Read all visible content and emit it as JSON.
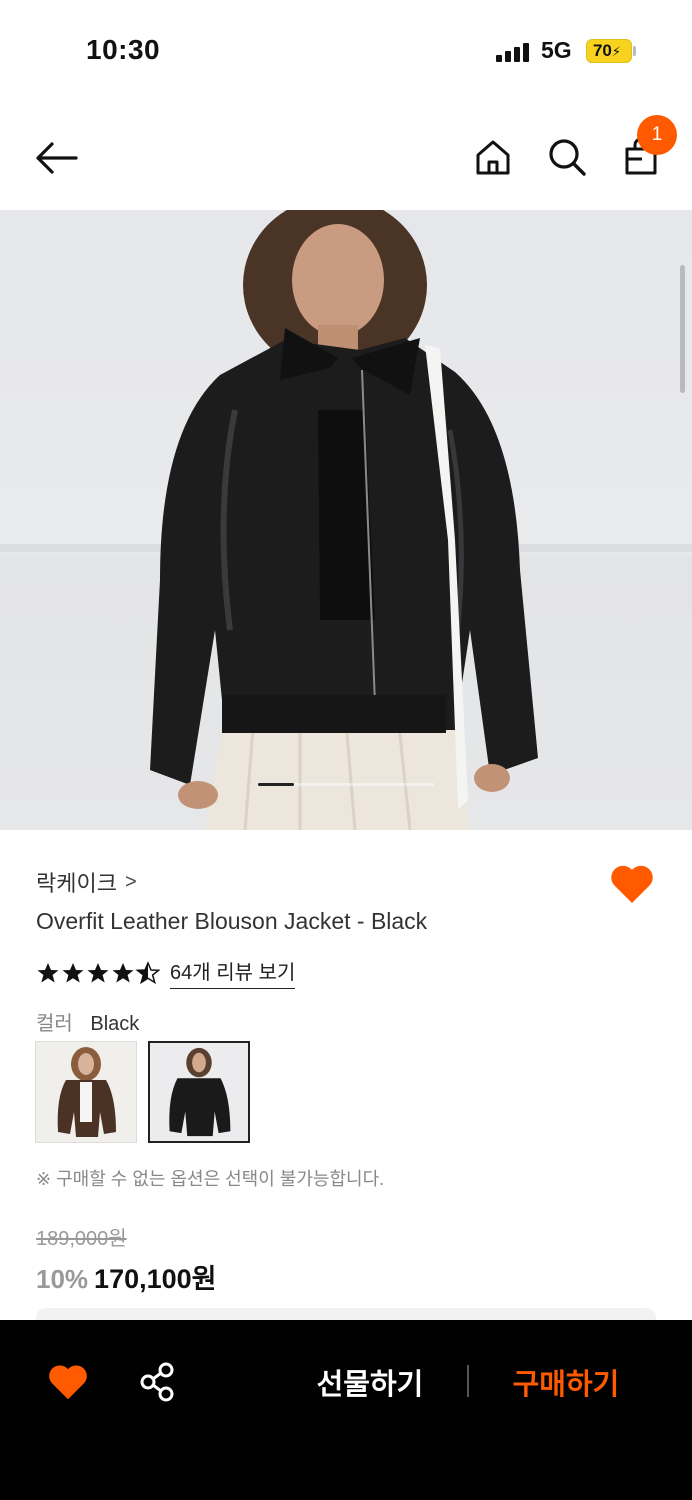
{
  "status_bar": {
    "time": "10:30",
    "network": "5G",
    "battery": "70"
  },
  "header": {
    "cart_count": "1",
    "icons": [
      "back-arrow-icon",
      "home-icon",
      "search-icon",
      "shopping-bag-icon"
    ]
  },
  "product": {
    "brand": "락케이크",
    "brand_chevron": ">",
    "title": "Overfit Leather Blouson Jacket - Black",
    "rating": 4.5,
    "review_link": "64개 리뷰 보기",
    "color_label": "컬러",
    "color_value": "Black",
    "swatches": [
      "Brown",
      "Black"
    ],
    "selected_swatch": "Black",
    "note": "※ 구매할 수 없는 옵션은 선택이 불가능합니다.",
    "original_price": "189,000원",
    "discount": "10%",
    "price": "170,100원",
    "wishlisted": true
  },
  "gallery": {
    "current_page": 1
  },
  "bottom_bar": {
    "gift_label": "선물하기",
    "buy_label": "구매하기"
  },
  "colors": {
    "accent": "#ff5a00",
    "background_bar": "#000000",
    "battery": "#f7d21f"
  }
}
